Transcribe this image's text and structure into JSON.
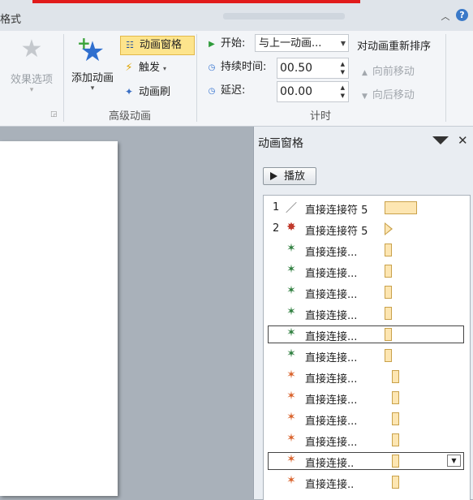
{
  "title_bar": {
    "tab_fragment": "格式"
  },
  "ribbon": {
    "effect_options": {
      "label": "效果选项"
    },
    "add_animation": {
      "label": "添加动画"
    },
    "advanced_group": {
      "label": "高级动画",
      "animation_pane": "动画窗格",
      "trigger": "触发",
      "animation_painter": "动画刷"
    },
    "timing_group": {
      "label": "计时",
      "start_label": "开始:",
      "start_value": "与上一动画...",
      "duration_label": "持续时间:",
      "duration_value": "00.50",
      "delay_label": "延迟:",
      "delay_value": "00.00"
    },
    "reorder": {
      "label": "对动画重新排序",
      "move_earlier": "向前移动",
      "move_later": "向后移动"
    }
  },
  "animation_pane": {
    "title": "动画窗格",
    "play_label": "播放",
    "items": [
      {
        "num": "1",
        "icon": "exit-line-icon",
        "name": "直接连接符 5",
        "type": "exit"
      },
      {
        "num": "2",
        "icon": "red-star-icon",
        "name": "直接连接符 5",
        "type": "emphasis"
      },
      {
        "num": "",
        "icon": "green-star-icon",
        "name": "直接连接...",
        "type": "entrance"
      },
      {
        "num": "",
        "icon": "green-star-icon",
        "name": "直接连接...",
        "type": "entrance"
      },
      {
        "num": "",
        "icon": "green-star-icon",
        "name": "直接连接...",
        "type": "entrance"
      },
      {
        "num": "",
        "icon": "green-star-icon",
        "name": "直接连接...",
        "type": "entrance"
      },
      {
        "num": "",
        "icon": "green-star-icon",
        "name": "直接连接...",
        "type": "entrance"
      },
      {
        "num": "",
        "icon": "green-star-icon",
        "name": "直接连接...",
        "type": "entrance"
      },
      {
        "num": "",
        "icon": "orange-star-icon",
        "name": "直接连接...",
        "type": "exit-star"
      },
      {
        "num": "",
        "icon": "orange-star-icon",
        "name": "直接连接...",
        "type": "exit-star"
      },
      {
        "num": "",
        "icon": "orange-star-icon",
        "name": "直接连接...",
        "type": "exit-star"
      },
      {
        "num": "",
        "icon": "orange-star-icon",
        "name": "直接连接...",
        "type": "exit-star"
      },
      {
        "num": "",
        "icon": "orange-star-icon",
        "name": "直接连接..",
        "type": "exit-star"
      },
      {
        "num": "",
        "icon": "orange-star-icon",
        "name": "直接连接..",
        "type": "exit-star"
      }
    ]
  }
}
